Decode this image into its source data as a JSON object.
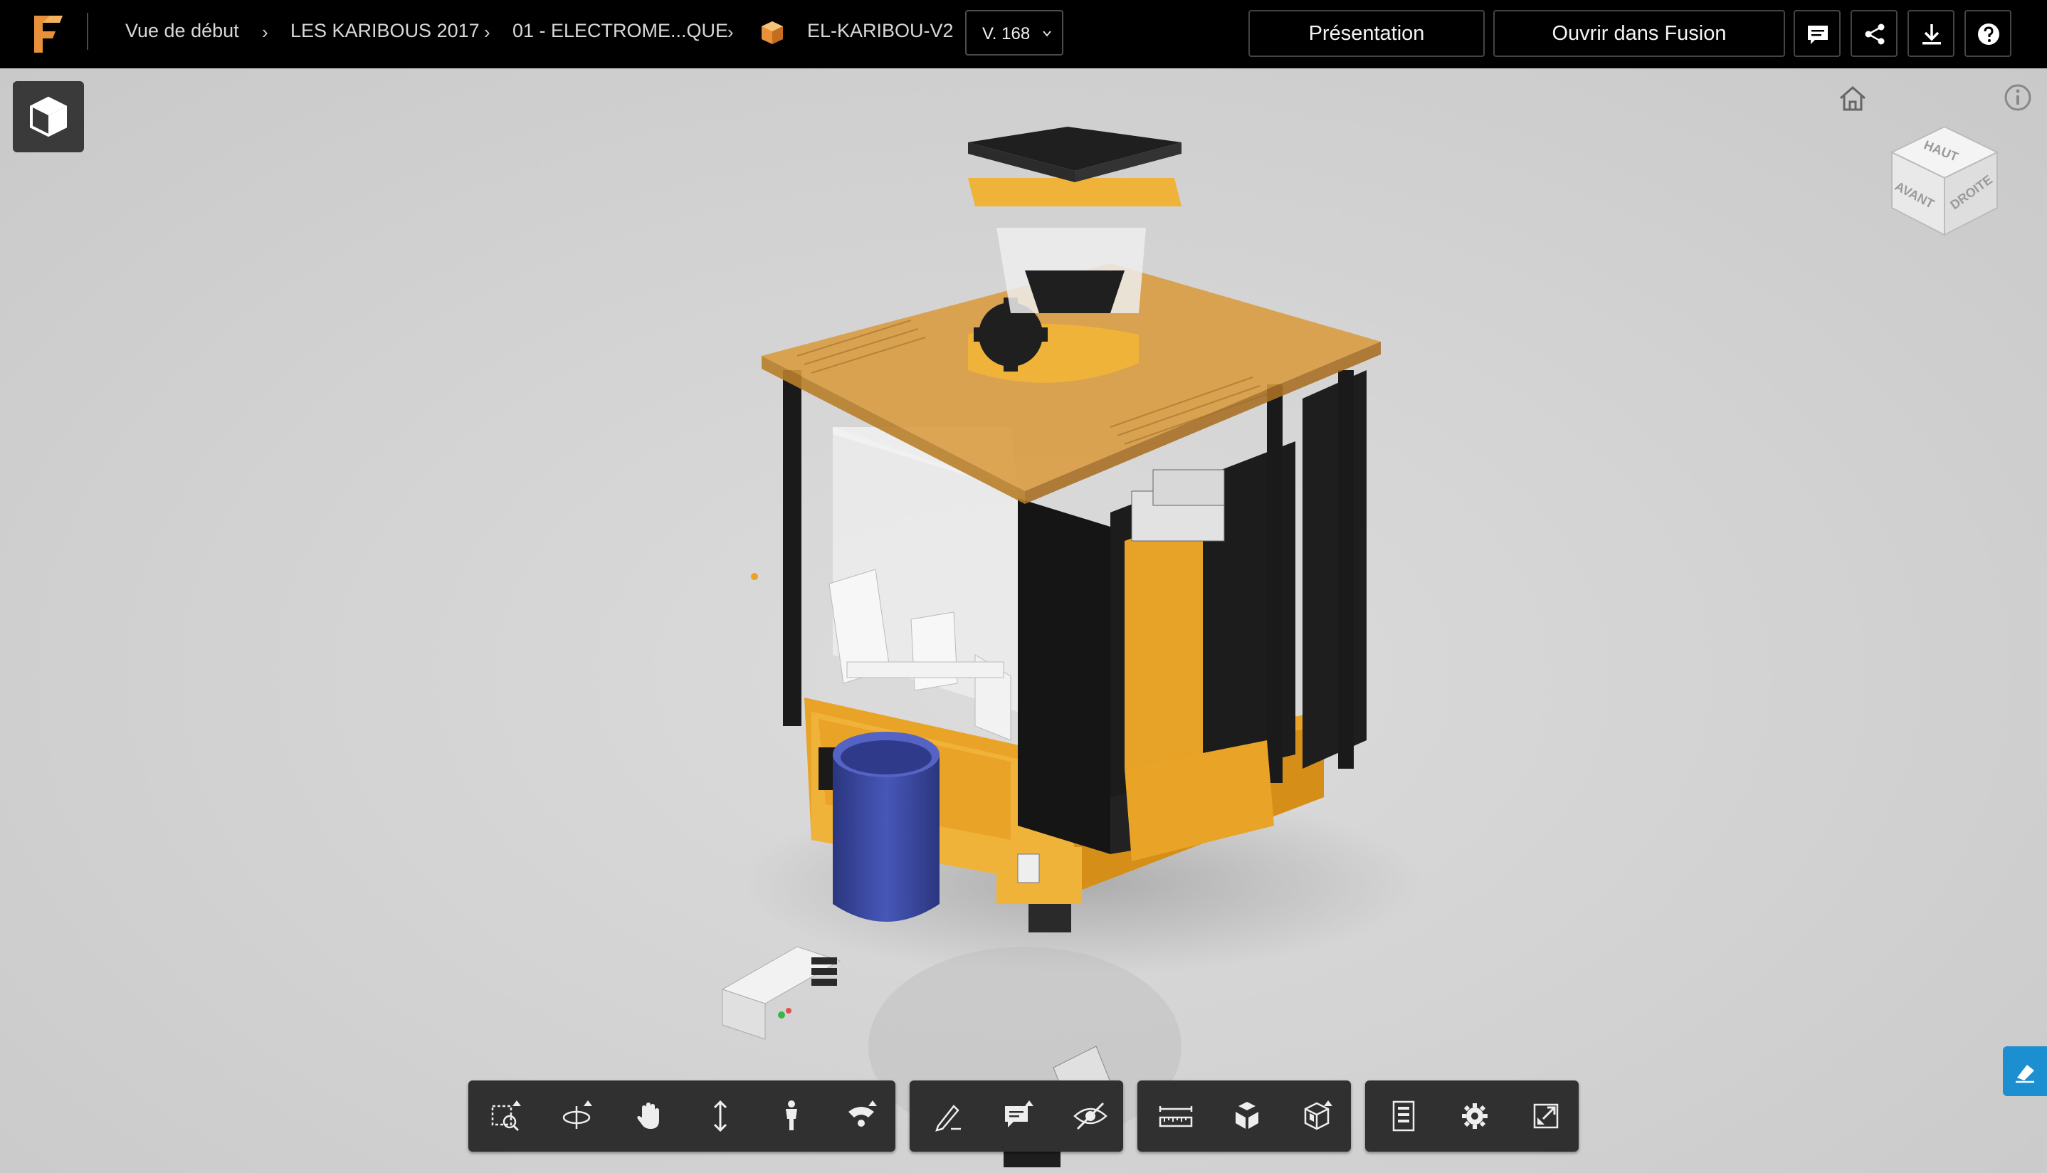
{
  "topbar": {
    "breadcrumb": [
      {
        "label": "Vue de début"
      },
      {
        "label": "LES KARIBOUS 2017"
      },
      {
        "label": "01 - ELECTROME...QUE"
      },
      {
        "label": "EL-KARIBOU-V2"
      }
    ],
    "version": "V. 168",
    "presentation_label": "Présentation",
    "open_in_fusion_label": "Ouvrir dans Fusion",
    "icon_buttons": [
      {
        "name": "comments-icon"
      },
      {
        "name": "share-icon"
      },
      {
        "name": "download-icon"
      },
      {
        "name": "help-icon"
      }
    ]
  },
  "viewcube": {
    "top": "HAUT",
    "front": "AVANT",
    "right": "DROITE"
  },
  "toolbar": {
    "groups": [
      {
        "tools": [
          "zoom-window-icon",
          "orbit-icon",
          "pan-icon",
          "zoom-icon",
          "first-person-icon",
          "fly-icon"
        ]
      },
      {
        "tools": [
          "markup-icon",
          "comment-icon",
          "hide-icon"
        ]
      },
      {
        "tools": [
          "measure-icon",
          "explode-icon",
          "section-icon"
        ]
      },
      {
        "tools": [
          "model-browser-icon",
          "settings-icon",
          "fullscreen-icon"
        ]
      }
    ]
  },
  "colors": {
    "topbar_bg": "#000000",
    "viewport_bg": "#d3d3d3",
    "toolbar_bg": "#303030",
    "accent_blue": "#1b8fd0",
    "model_orange": "#f0a830",
    "bucket_blue": "#3c4aa8"
  }
}
